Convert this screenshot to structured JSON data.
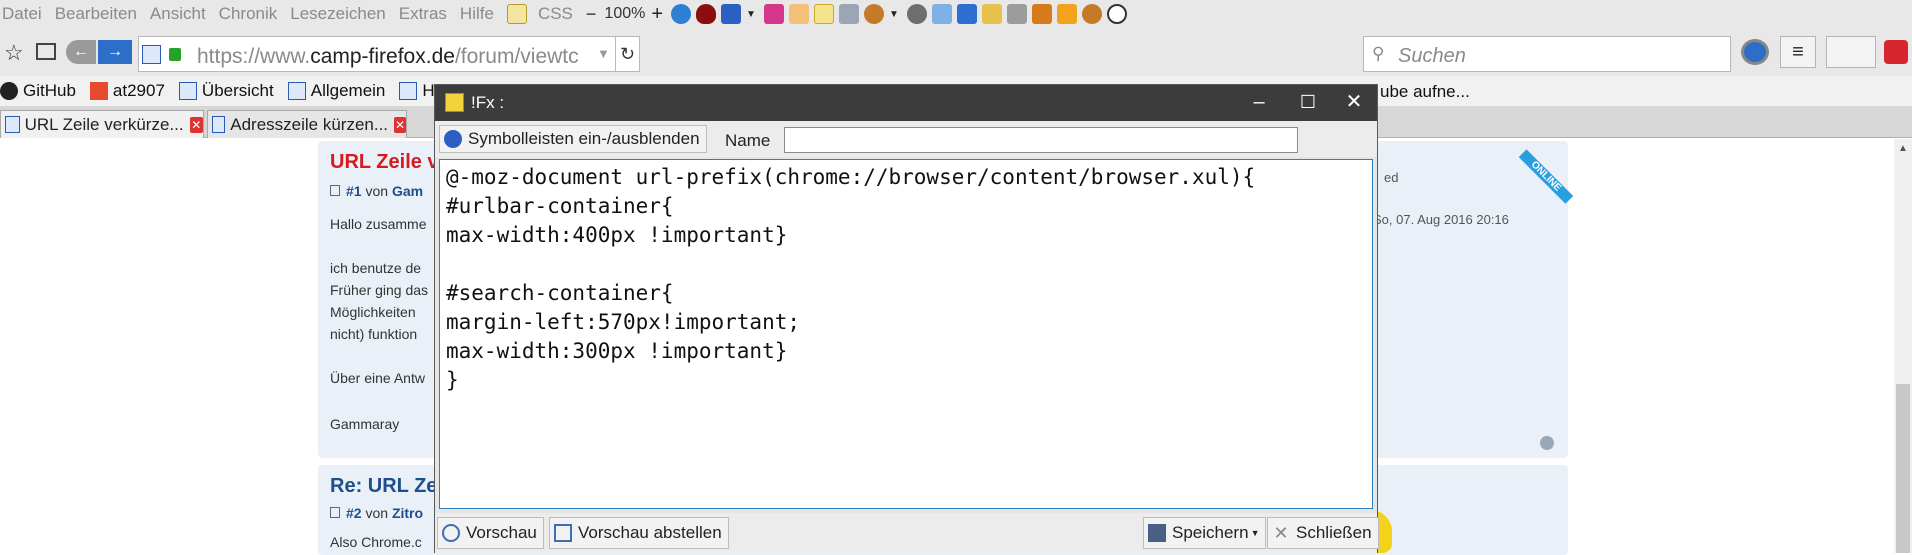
{
  "menubar": {
    "items": [
      "Datei",
      "Bearbeiten",
      "Ansicht",
      "Chronik",
      "Lesezeichen",
      "Extras",
      "Hilfe"
    ],
    "css_label": "CSS",
    "zoom": "100%"
  },
  "navbar": {
    "url_prefix": "https://www.",
    "url_host": "camp-firefox.de",
    "url_path": "/forum/viewtc",
    "search_placeholder": "Suchen"
  },
  "bookmarks": {
    "items": [
      "GitHub",
      "at2907",
      "Übersicht",
      "Allgemein",
      "H"
    ],
    "overflow_text": "ube aufne..."
  },
  "tabs": [
    {
      "label": "URL Zeile verkürze..."
    },
    {
      "label": "Adresszeile kürzen..."
    }
  ],
  "page": {
    "post1": {
      "title": "URL Zeile v",
      "meta_num": "#1",
      "meta_by": "von",
      "meta_author": "Gam",
      "lines": [
        "Hallo zusamme",
        "ich benutze de",
        "Früher ging das",
        "Möglichkeiten",
        "nicht) funktion",
        "Über eine Antw",
        "Gammaray"
      ],
      "side_text": "ed",
      "side_date": "So, 07. Aug 2016 20:16",
      "ribbon": "ONLINE"
    },
    "post2": {
      "title": "Re: URL Zei",
      "meta_num": "#2",
      "meta_by": "von",
      "meta_author": "Zitro",
      "line": "Also Chrome.c"
    }
  },
  "dialog": {
    "title": "!Fx :",
    "toggle_label": "Symbolleisten ein-/ausblenden",
    "name_label": "Name",
    "name_value": "",
    "code": "@-moz-document url-prefix(chrome://browser/content/browser.xul){\n#urlbar-container{\nmax-width:400px !important}\n\n#search-container{\nmargin-left:570px!important;\nmax-width:300px !important}\n}",
    "buttons": {
      "preview": "Vorschau",
      "stop_preview": "Vorschau abstellen",
      "save": "Speichern",
      "close": "Schließen"
    }
  },
  "colors": {
    "dialog_titlebar": "#3c3c3c",
    "editor_border": "#2e7fc3",
    "post_title_red": "#d71920",
    "post_title_blue": "#1f4e8c",
    "chrome_bg": "#e8e8e8"
  }
}
